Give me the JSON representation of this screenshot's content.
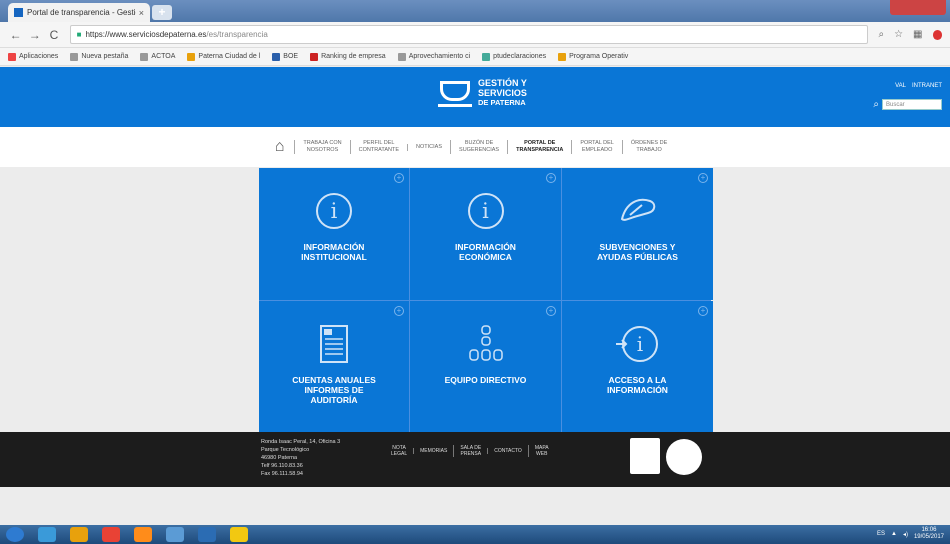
{
  "browser": {
    "tab_title": "Portal de transparencia - Gestió",
    "tab_close": "×",
    "new_tab": "+",
    "address_host": "https://www.serviciosdepaterna.es",
    "address_path": "/es/transparencia",
    "bookmarks": [
      {
        "label": "Aplicaciones",
        "color": "#e44"
      },
      {
        "label": "Nueva pestaña",
        "color": "#999"
      },
      {
        "label": "ACTOA",
        "color": "#999"
      },
      {
        "label": "Paterna Ciudad de l",
        "color": "#e8a10c"
      },
      {
        "label": "BOE",
        "color": "#2b5faa"
      },
      {
        "label": "Ranking de empresa",
        "color": "#c22"
      },
      {
        "label": "Aprovechamiento ci",
        "color": "#999"
      },
      {
        "label": "ptudeclaraciones",
        "color": "#4a9"
      },
      {
        "label": "Programa Operativ",
        "color": "#e8a10c"
      }
    ]
  },
  "header": {
    "logo_line1": "GESTIÓN Y",
    "logo_line2": "SERVICIOS",
    "logo_line3": "DE PATERNA",
    "links": [
      "VAL",
      "INTRANET"
    ],
    "search_placeholder": "Buscar"
  },
  "nav": {
    "items": [
      {
        "label": "TRABAJA CON\nNOSOTROS",
        "active": false
      },
      {
        "label": "PERFIL DEL\nCONTRATANTE",
        "active": false
      },
      {
        "label": "NOTICIAS",
        "active": false
      },
      {
        "label": "BUZÓN DE\nSUGERENCIAS",
        "active": false
      },
      {
        "label": "PORTAL DE\nTRANSPARENCIA",
        "active": true
      },
      {
        "label": "PORTAL DEL\nEMPLEADO",
        "active": false
      },
      {
        "label": "ÓRDENES DE\nTRABAJO",
        "active": false
      }
    ]
  },
  "tiles": [
    {
      "label": "INFORMACIÓN\nINSTITUCIONAL",
      "icon": "info-circle-icon"
    },
    {
      "label": "INFORMACIÓN\nECONÓMICA",
      "icon": "info-circle-icon"
    },
    {
      "label": "SUBVENCIONES Y\nAYUDAS PÚBLICAS",
      "icon": "handshake-icon"
    },
    {
      "label": "CUENTAS ANUALES\nINFORMES DE\nAUDITORÍA",
      "icon": "document-icon"
    },
    {
      "label": "EQUIPO DIRECTIVO",
      "icon": "org-chart-icon"
    },
    {
      "label": "ACCESO A LA\nINFORMACIÓN",
      "icon": "info-arrow-icon"
    }
  ],
  "footer": {
    "address": [
      "Ronda Isaac Peral, 14, Oficina 3",
      "Parque Tecnológico",
      "46980 Paterna",
      "Telf 96.110.83.36",
      "Fax 96.111.58.94"
    ],
    "links": [
      "NOTA\nLEGAL",
      "MEMORIAS",
      "SALA DE\nPRENSA",
      "CONTACTO",
      "MAPA\nWEB"
    ]
  },
  "taskbar": {
    "time": "16:06",
    "date": "19/05/2017"
  }
}
